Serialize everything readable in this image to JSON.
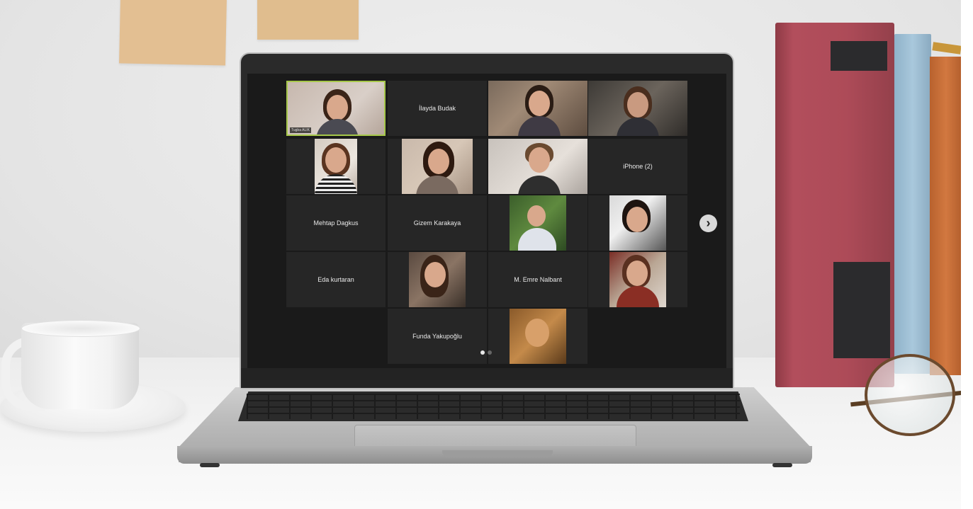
{
  "meeting": {
    "participants": [
      {
        "name": "Tugba",
        "chip": "Tugba ALIK",
        "has_video": true,
        "active_speaker": true
      },
      {
        "name": "İlayda Budak",
        "has_video": false
      },
      {
        "name": "",
        "has_video": true
      },
      {
        "name": "",
        "has_video": true
      },
      {
        "name": "",
        "has_video": true
      },
      {
        "name": "",
        "has_video": true
      },
      {
        "name": "",
        "has_video": true
      },
      {
        "name": "iPhone (2)",
        "has_video": false
      },
      {
        "name": "Mehtap Dagkus",
        "has_video": false
      },
      {
        "name": "Gizem Karakaya",
        "has_video": false
      },
      {
        "name": "",
        "has_video": true
      },
      {
        "name": "",
        "has_video": true
      },
      {
        "name": "Eda kurtaran",
        "has_video": false
      },
      {
        "name": "",
        "has_video": true
      },
      {
        "name": "M. Emre Nalbant",
        "has_video": false
      },
      {
        "name": "",
        "has_video": true
      },
      {
        "name": "Funda Yakupoğlu",
        "has_video": false
      },
      {
        "name": "",
        "has_video": true
      }
    ],
    "pagination": {
      "current_page": 1,
      "total_pages": 2
    },
    "next_page_icon": "chevron-right-icon",
    "accent_color": "#a6c74a"
  }
}
